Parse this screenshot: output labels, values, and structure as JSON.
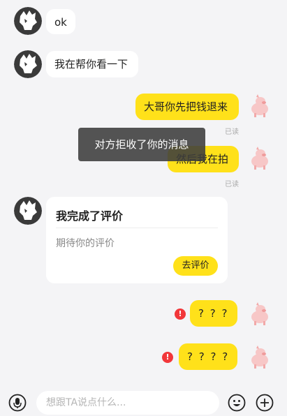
{
  "messages": [
    {
      "side": "in",
      "text": "ok"
    },
    {
      "side": "in",
      "text": "我在帮你看一下"
    },
    {
      "side": "out",
      "text": "大哥你先把钱退来",
      "status": "已读"
    },
    {
      "side": "out",
      "text": "然后我在拍",
      "status": "已读"
    },
    {
      "side": "out",
      "text": "? ? ?",
      "failed": true
    },
    {
      "side": "out",
      "text": "? ? ? ?",
      "failed": true
    }
  ],
  "toast": "对方拒收了你的消息",
  "review_card": {
    "title": "我完成了评价",
    "subtitle": "期待你的评价",
    "button": "去评价"
  },
  "input_bar": {
    "placeholder": "想跟TA说点什么..."
  },
  "icons": {
    "mic": "microphone-icon",
    "emoji": "emoji-icon",
    "plus": "plus-icon",
    "alert": "exclamation-icon"
  },
  "colors": {
    "accent": "#ffe11a",
    "background": "#f4f4f6",
    "alert": "#f2373a"
  }
}
